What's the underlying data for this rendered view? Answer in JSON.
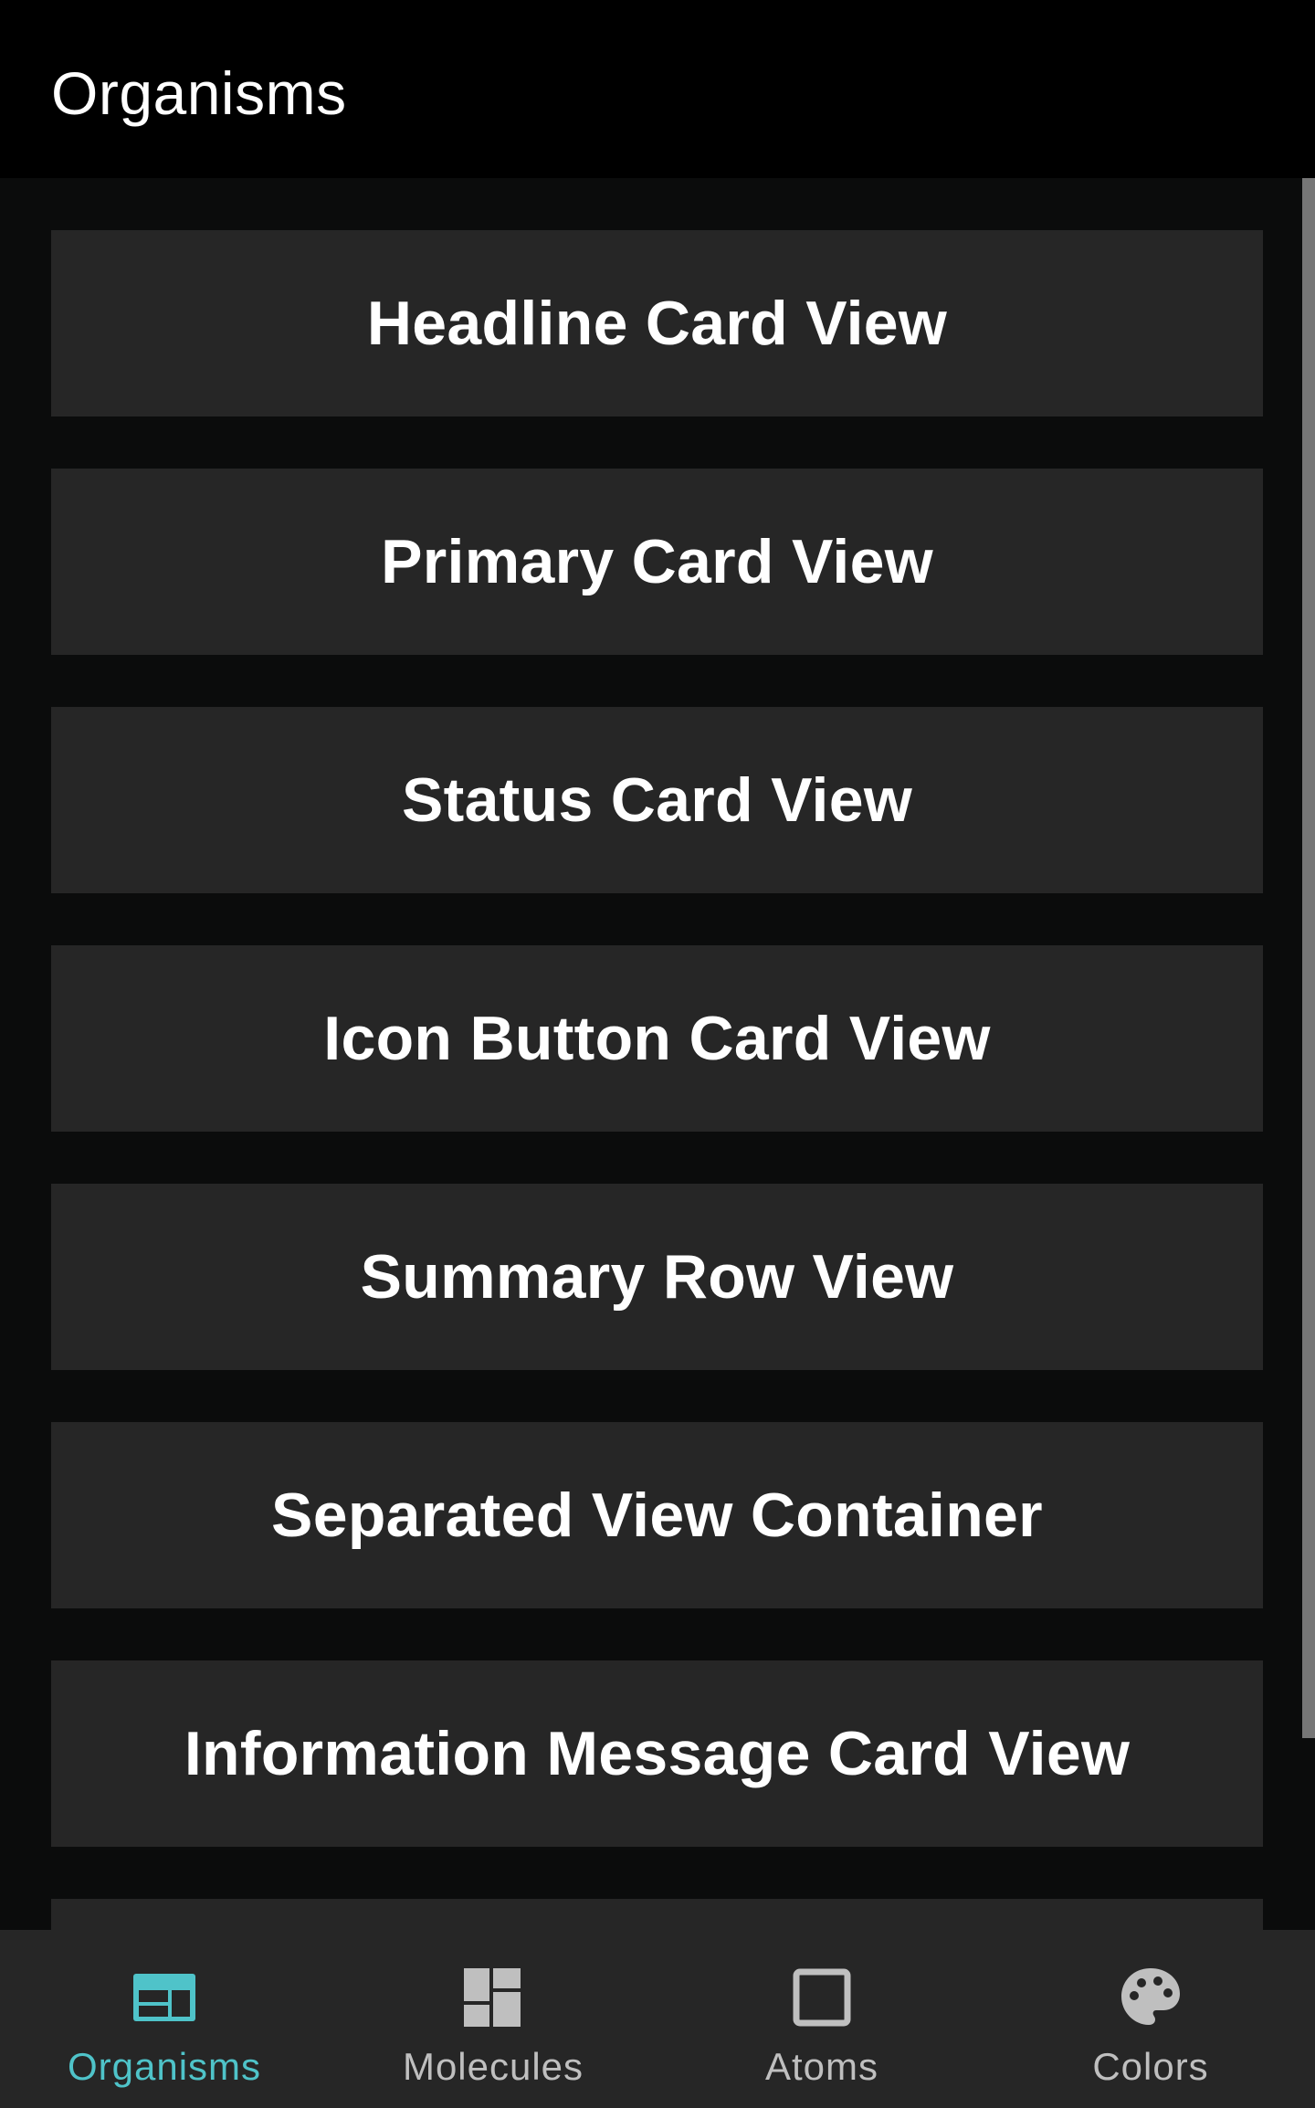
{
  "app_bar": {
    "title": "Organisms"
  },
  "cards": [
    {
      "label": "Headline Card View"
    },
    {
      "label": "Primary Card View"
    },
    {
      "label": "Status Card View"
    },
    {
      "label": "Icon Button Card View"
    },
    {
      "label": "Summary Row View"
    },
    {
      "label": "Separated View Container"
    },
    {
      "label": "Information Message Card View"
    },
    {
      "label": ""
    }
  ],
  "bottom_nav": {
    "items": [
      {
        "label": "Organisms",
        "icon": "organisms-icon",
        "active": true
      },
      {
        "label": "Molecules",
        "icon": "molecules-icon",
        "active": false
      },
      {
        "label": "Atoms",
        "icon": "atoms-icon",
        "active": false
      },
      {
        "label": "Colors",
        "icon": "palette-icon",
        "active": false
      }
    ]
  },
  "colors": {
    "app_bar_bg": "#000000",
    "page_bg": "#0b0c0c",
    "card_bg": "#262626",
    "accent": "#4fc3c9",
    "inactive": "#bfbfbf",
    "text": "#ffffff"
  }
}
